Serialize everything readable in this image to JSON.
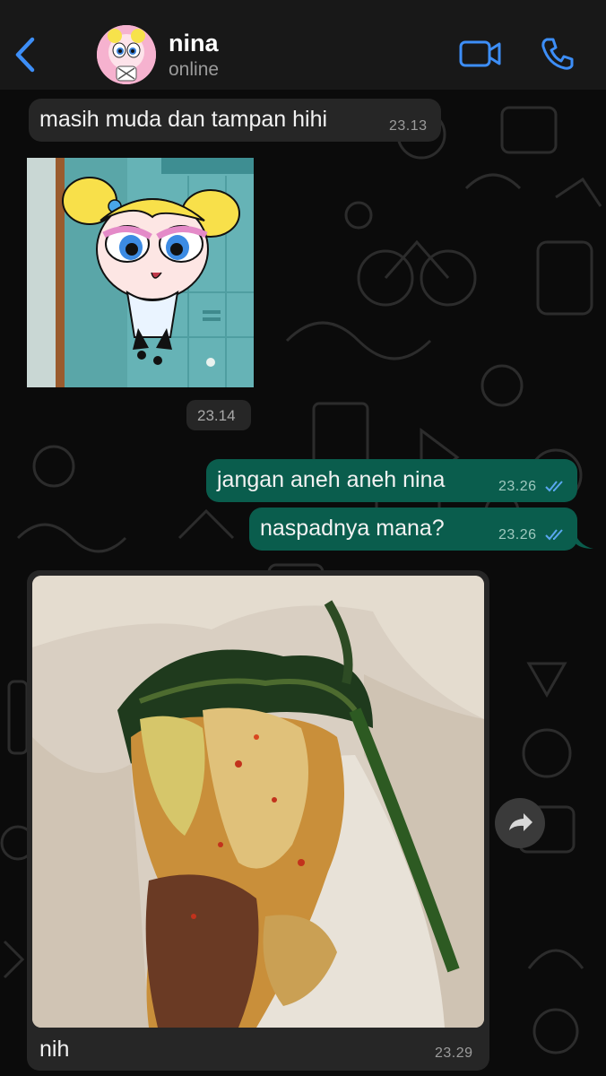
{
  "header": {
    "contact_name": "nina",
    "status": "online",
    "accent": "#3d8ef7"
  },
  "messages": [
    {
      "direction": "in",
      "type": "text",
      "text": "masih muda dan tampan hihi",
      "time": "23.13"
    },
    {
      "direction": "in",
      "type": "image",
      "image": "cartoon-girl-sticker",
      "time": "23.14"
    },
    {
      "direction": "out",
      "type": "text",
      "text": "jangan aneh aneh nina",
      "time": "23.26",
      "status": "read"
    },
    {
      "direction": "out",
      "type": "text",
      "text": "naspadnya mana?",
      "time": "23.26",
      "status": "read"
    },
    {
      "direction": "in",
      "type": "image",
      "image": "food-photo",
      "caption": "nih",
      "time": "23.29"
    }
  ],
  "icons": {
    "back": "chevron-left-icon",
    "video": "video-camera-icon",
    "call": "phone-icon",
    "forward": "forward-arrow-icon",
    "read": "double-check-icon"
  },
  "colors": {
    "incoming_bubble": "#262626",
    "outgoing_bubble": "#0a5d4d",
    "read_tick": "#5aa7f0"
  }
}
